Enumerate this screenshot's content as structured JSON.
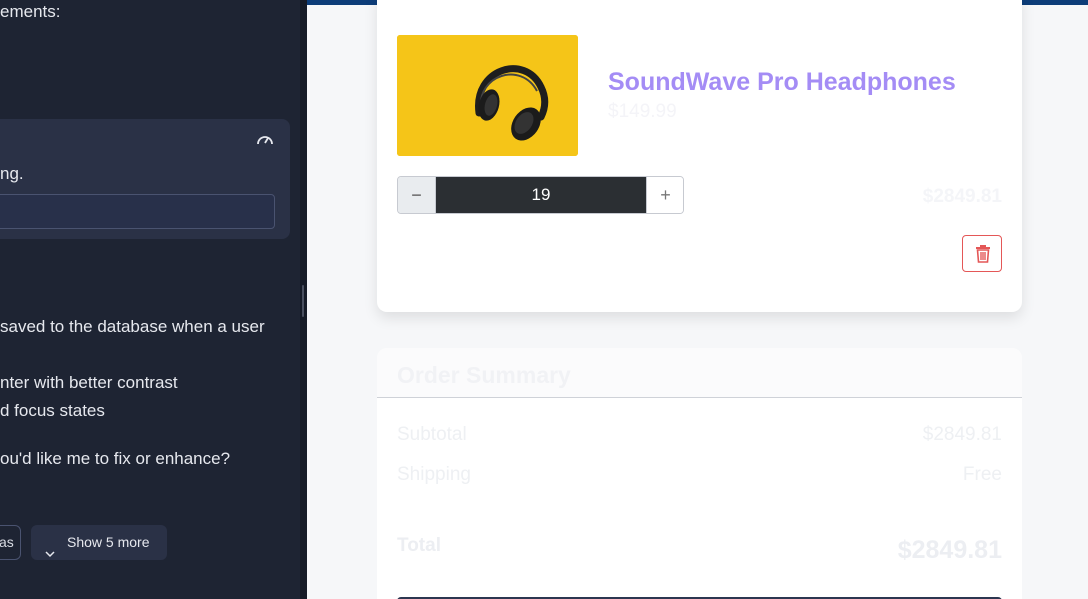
{
  "chat": {
    "heading_fragment": "ements:",
    "card_text": "ng.",
    "lines": [
      "saved to the database when a user",
      "nter with better contrast",
      "d focus states",
      "ou'd like me to fix or enhance?"
    ],
    "chip_partial": "as",
    "show_more": "Show 5 more",
    "icons": [
      "gauge-icon",
      "chevron-down-icon"
    ]
  },
  "cart_item": {
    "name": "SoundWave Pro Headphones",
    "unit_price": "$149.99",
    "quantity": "19",
    "minus": "−",
    "plus": "+",
    "line_total": "$2849.81",
    "icons": [
      "headphones-image",
      "trash-icon"
    ]
  },
  "summary": {
    "title": "Order Summary",
    "subtotal_label": "Subtotal",
    "subtotal_value": "$2849.81",
    "shipping_label": "Shipping",
    "shipping_value": "Free",
    "total_label": "Total",
    "total_value": "$2849.81"
  },
  "colors": {
    "chat_bg": "#1e2433",
    "accent_title": "#a48cf5",
    "topbar": "#0d3d79",
    "danger": "#e45757",
    "thumb_bg": "#f5c518"
  }
}
